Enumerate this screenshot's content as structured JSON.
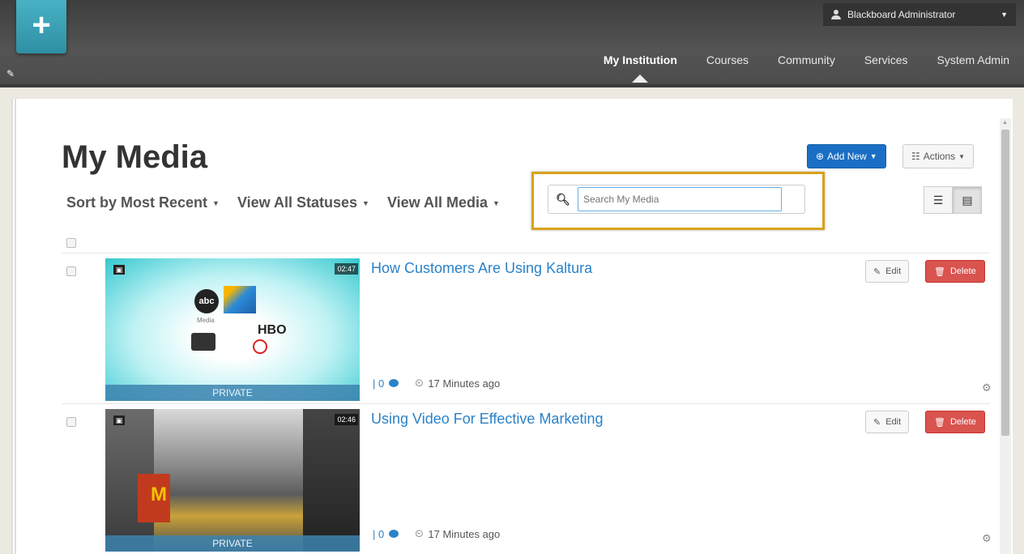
{
  "header": {
    "user_name": "Blackboard Administrator",
    "nav": [
      {
        "label": "My Institution",
        "active": true
      },
      {
        "label": "Courses"
      },
      {
        "label": "Community"
      },
      {
        "label": "Services"
      },
      {
        "label": "System Admin"
      }
    ]
  },
  "page": {
    "title": "My Media",
    "add_new_label": "Add New",
    "actions_label": "Actions",
    "filters": {
      "sort": "Sort by Most Recent",
      "statuses": "View All Statuses",
      "media": "View All Media"
    },
    "search": {
      "placeholder": "Search My Media"
    }
  },
  "media_items": [
    {
      "title": "How Customers Are Using Kaltura",
      "duration": "02:47",
      "status": "PRIVATE",
      "comments": "0",
      "time": "17 Minutes ago",
      "edit_label": "Edit",
      "delete_label": "Delete",
      "thumb_text": {
        "abc": "abc",
        "media": "Media",
        "hbo": "HBO"
      }
    },
    {
      "title": "Using Video For Effective Marketing",
      "duration": "02:46",
      "status": "PRIVATE",
      "comments": "0",
      "time": "17 Minutes ago",
      "edit_label": "Edit",
      "delete_label": "Delete"
    }
  ],
  "colors": {
    "primary_blue": "#1a6fc4",
    "link_blue": "#2a82c9",
    "danger_red": "#d9534f",
    "highlight_gold": "#d9a21b",
    "plus_teal": "#3aa3b6"
  }
}
